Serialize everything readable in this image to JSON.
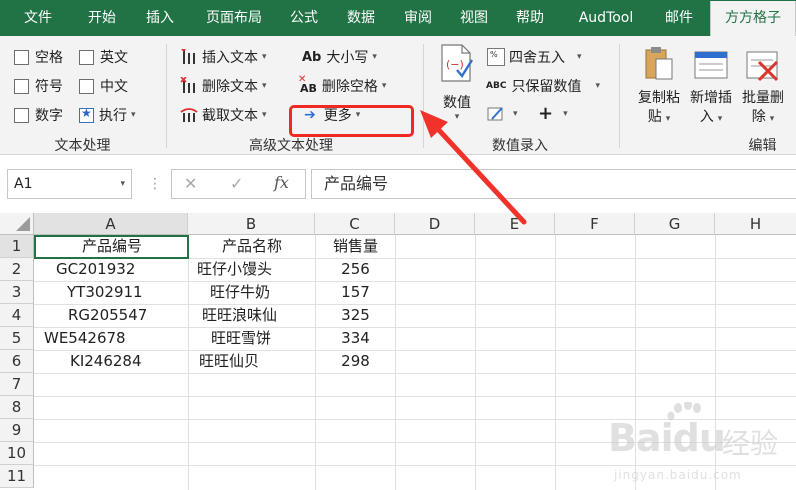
{
  "menu": {
    "tabs": [
      "文件",
      "开始",
      "插入",
      "页面布局",
      "公式",
      "数据",
      "审阅",
      "视图",
      "帮助",
      "AudTool",
      "邮件",
      "方方格子"
    ],
    "active_tab": "方方格子"
  },
  "ribbon": {
    "text_processing": {
      "checkboxes": [
        "空格",
        "英文",
        "符号",
        "中文",
        "数字"
      ],
      "execute": "执行",
      "label": "文本处理"
    },
    "advanced_text": {
      "insert_text": "插入文本",
      "delete_text": "删除文本",
      "extract_text": "截取文本",
      "case_icon": "Ab",
      "case": "大小写",
      "delete_spaces_icon": "AB",
      "delete_spaces": "删除空格",
      "more": "更多",
      "label": "高级文本处理"
    },
    "numeric_entry": {
      "value_big": "数值",
      "round": "四舍五入",
      "keep_values_icon": "ABC",
      "keep_values": "只保留数值",
      "plus": "+",
      "label": "数值录入"
    },
    "edit": {
      "copy_paste_line1": "复制粘",
      "copy_paste_line2": "贴",
      "add_insert_line1": "新增插",
      "add_insert_line2": "入",
      "batch_delete_line1": "批量删",
      "batch_delete_line2": "除",
      "label": "编辑"
    }
  },
  "formula_bar": {
    "name_box": "A1",
    "cancel": "✕",
    "confirm": "✓",
    "fx": "fx",
    "content": "产品编号"
  },
  "sheet": {
    "columns": [
      "A",
      "B",
      "C",
      "D",
      "E",
      "F",
      "G",
      "H"
    ],
    "row_numbers": [
      "1",
      "2",
      "3",
      "4",
      "5",
      "6",
      "7",
      "8",
      "9",
      "10",
      "11"
    ],
    "rows": [
      [
        "产品编号",
        "产品名称",
        "销售量"
      ],
      [
        "GC201932",
        "旺仔小馒头",
        "256"
      ],
      [
        "YT302911",
        "旺仔牛奶",
        "157"
      ],
      [
        "RG205547",
        "旺旺浪味仙",
        "325"
      ],
      [
        "WE542678",
        "旺旺雪饼",
        "334"
      ],
      [
        "KI246284",
        "旺旺仙贝",
        "298"
      ]
    ]
  },
  "watermark": {
    "brand": "Baidu",
    "cn": "经验",
    "url": "jingyan.baidu.com"
  },
  "colors": {
    "menu_green": "#217346",
    "highlight_red": "#f02a22",
    "ribbon_bg": "#f3f3f3"
  }
}
